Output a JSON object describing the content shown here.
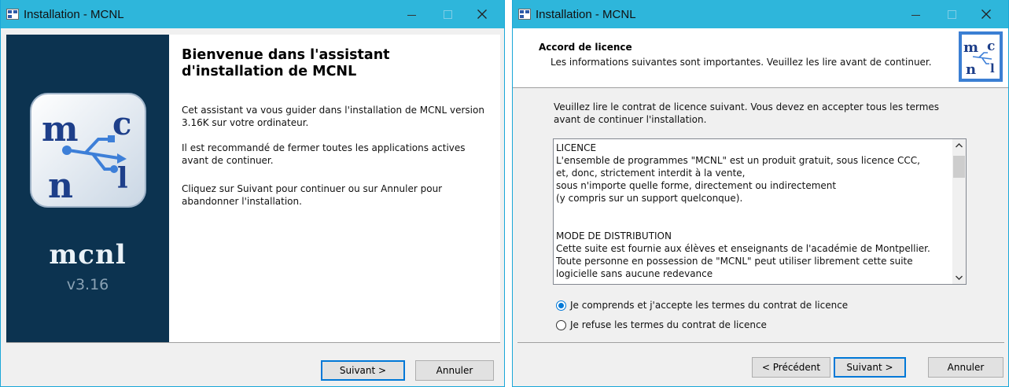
{
  "window1": {
    "title": "Installation - MCNL",
    "side_brand": "mcnl",
    "side_version": "v3.16",
    "heading": "Bienvenue dans l'assistant d'installation de MCNL",
    "paragraphs": [
      "Cet assistant va vous guider dans l'installation de MCNL version 3.16K sur votre ordinateur.",
      "Il est recommandé de fermer toutes les applications actives avant de continuer.",
      "Cliquez sur Suivant pour continuer ou sur Annuler pour abandonner l'installation."
    ],
    "buttons": {
      "next": "Suivant >",
      "cancel": "Annuler"
    }
  },
  "window2": {
    "title": "Installation - MCNL",
    "header_title": "Accord de licence",
    "header_subtitle": "Les informations suivantes sont importantes. Veuillez les lire avant de continuer.",
    "intro": "Veuillez lire le contrat de licence suivant. Vous devez en accepter tous les termes avant de continuer l'installation.",
    "license_text": "LICENCE\nL'ensemble de programmes \"MCNL\" est un produit gratuit, sous licence CCC,\net, donc, strictement interdit à la vente,\nsous n'importe quelle forme, directement ou indirectement\n(y compris sur un support quelconque).\n\n\nMODE DE DISTRIBUTION\nCette suite est fournie aux élèves et enseignants de l'académie de Montpellier.\nToute personne en possession de \"MCNL\" peut utiliser librement cette suite\nlogicielle sans aucune redevance",
    "radio_accept": "Je comprends et j'accepte les termes du contrat de licence",
    "radio_refuse": "Je refuse les termes du contrat de licence",
    "accept_selected": true,
    "buttons": {
      "back": "< Précédent",
      "next": "Suivant >",
      "cancel": "Annuler"
    }
  },
  "colors": {
    "titlebar": "#2eb6db",
    "side_panel": "#0c3350",
    "accent": "#0078d7",
    "logo_blue": "#2e5aa8"
  },
  "icons": [
    "app-icon",
    "minimize-icon",
    "maximize-icon",
    "close-icon",
    "scroll-up-icon",
    "scroll-down-icon",
    "mcnl-logo"
  ]
}
